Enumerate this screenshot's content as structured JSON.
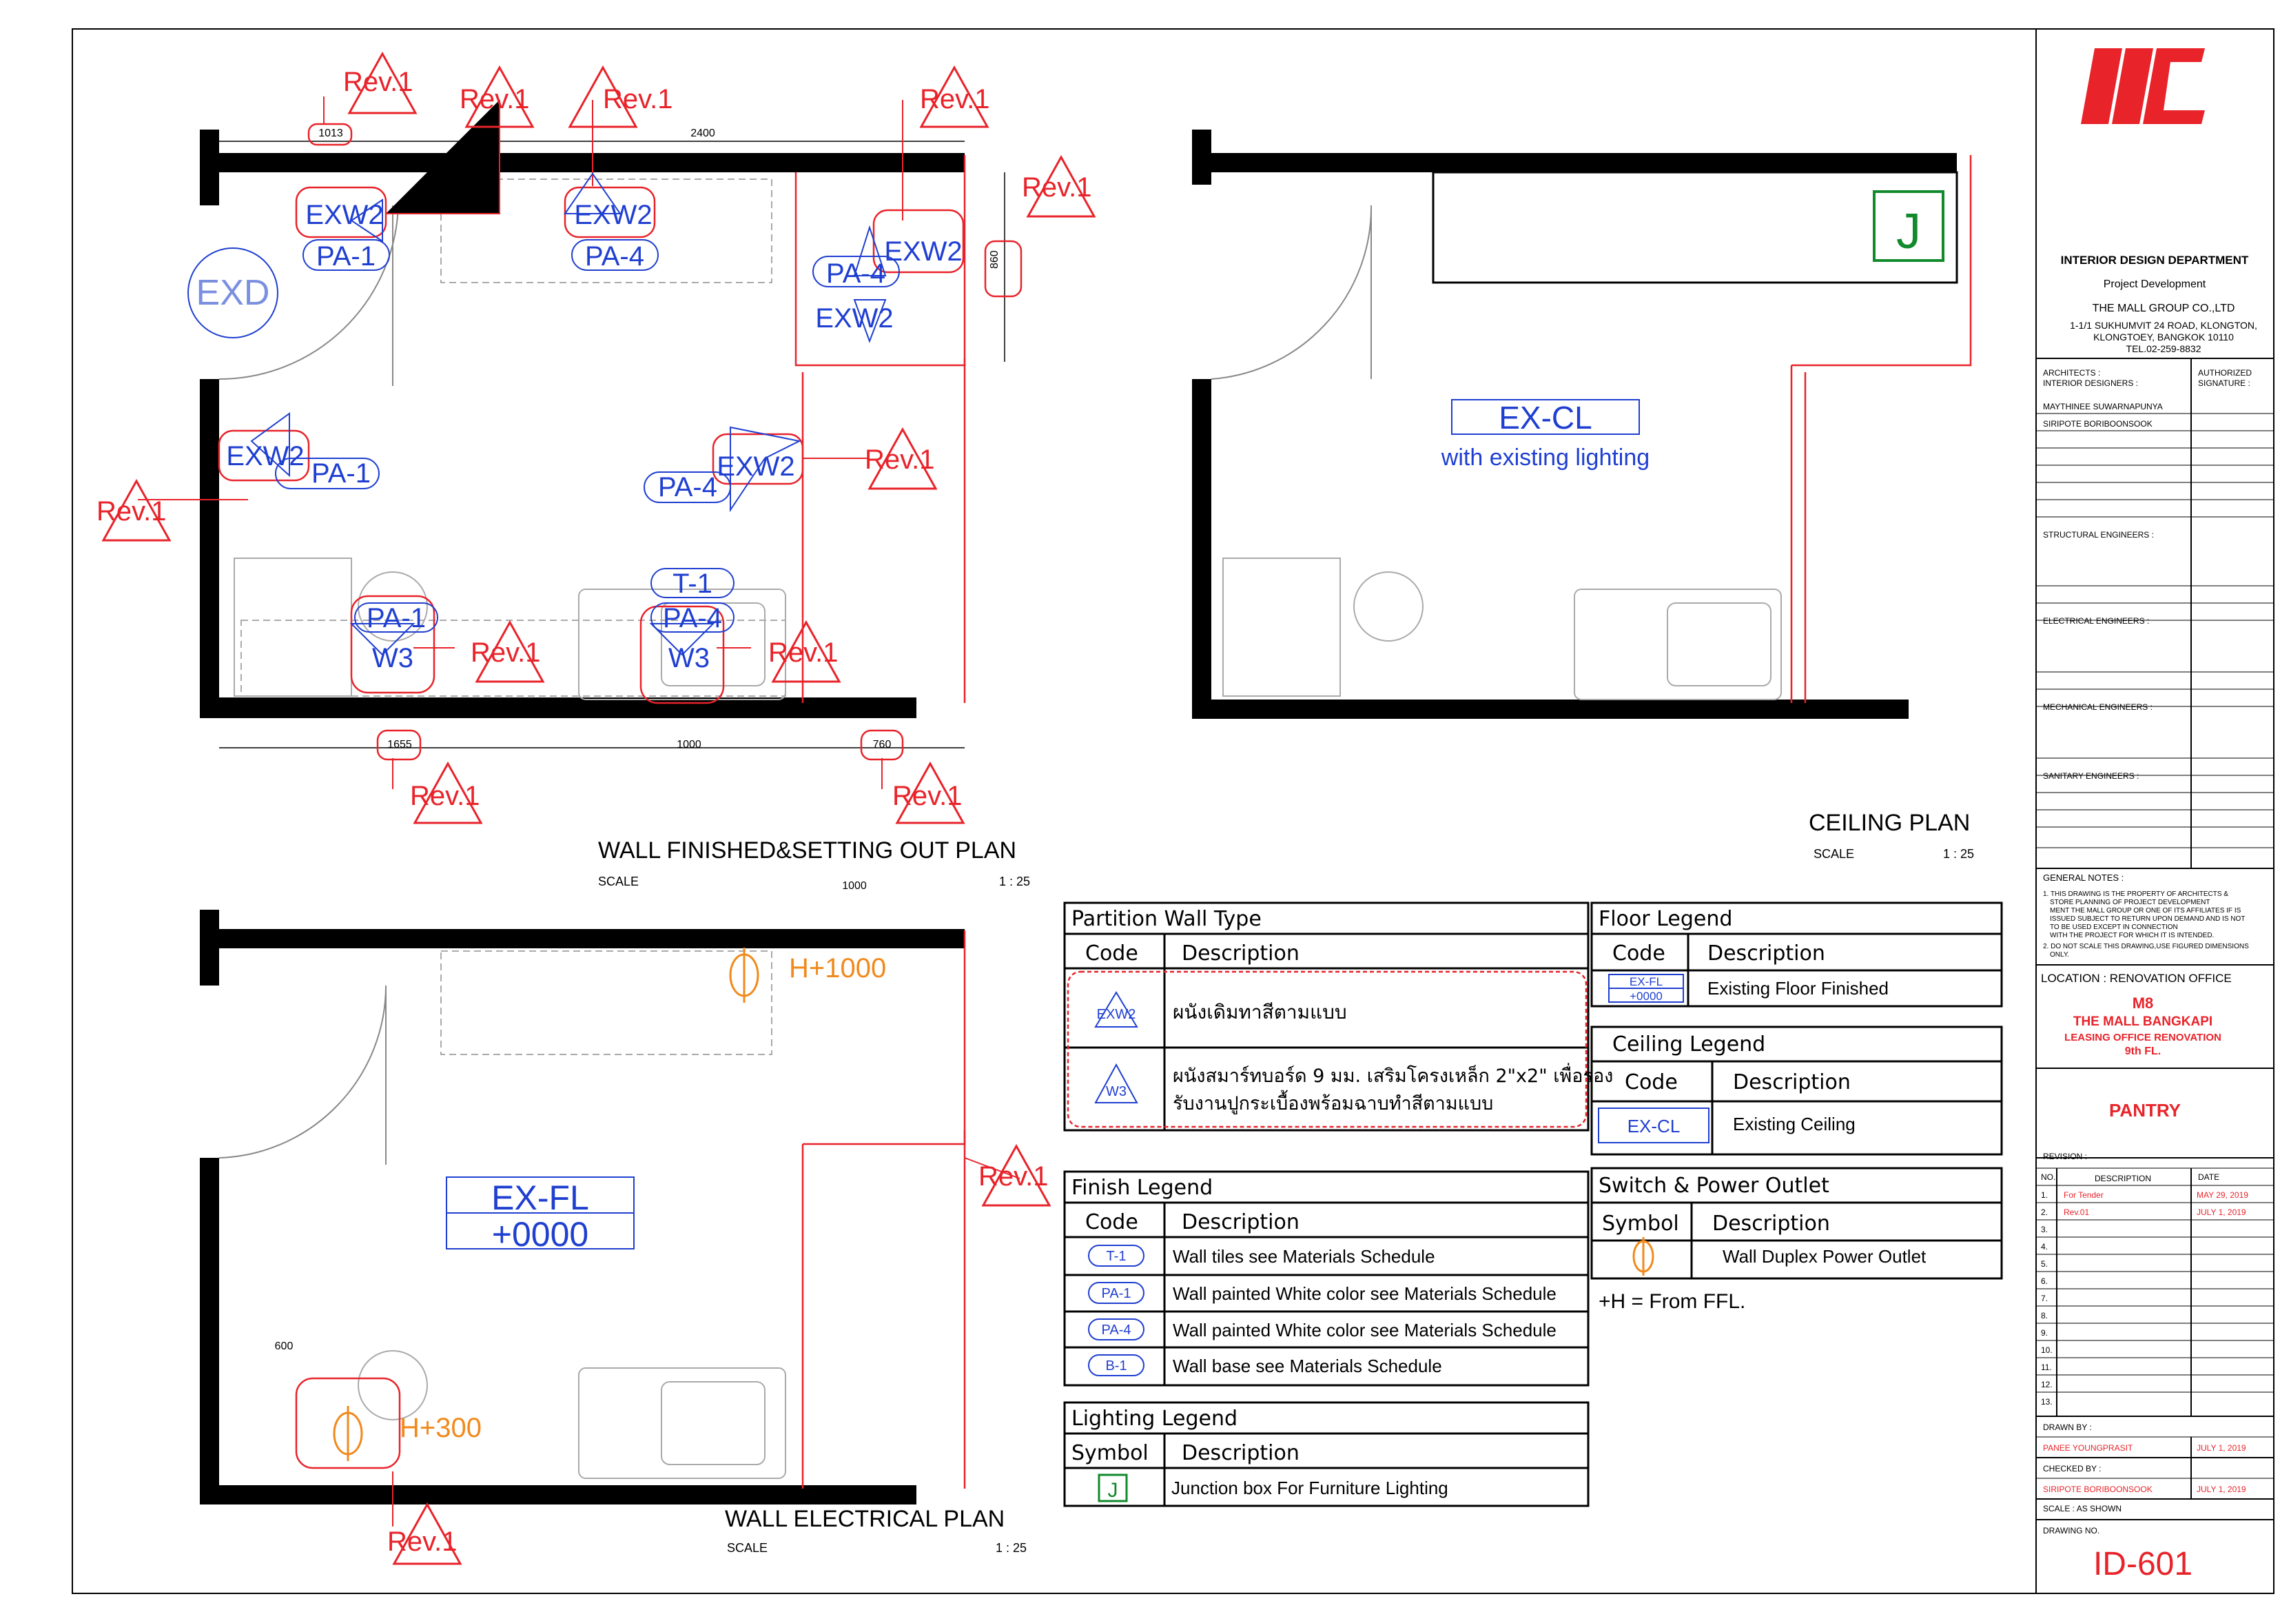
{
  "colors": {
    "wall": "#000000",
    "red": "#e8232a",
    "blue": "#1f3fd1",
    "orange": "#f08a1c",
    "green": "#118a2c",
    "grey": "#9a9a9a"
  },
  "plans": {
    "wall_finished": {
      "title": "WALL FINISHED&SETTING OUT PLAN",
      "scale_label": "SCALE",
      "scale": "1 : 25",
      "rev": "Rev.1",
      "dims": {
        "d1013": "1013",
        "d2400": "2400",
        "d860": "860",
        "d1655": "1655",
        "d1000": "1000",
        "d760": "760"
      },
      "door_tag": "EXD",
      "tags": {
        "exw2": "EXW2",
        "pa1": "PA-1",
        "pa4": "PA-4",
        "t1": "T-1",
        "w3": "W3"
      }
    },
    "ceiling": {
      "title": "CEILING PLAN",
      "scale_label": "SCALE",
      "scale": "1 : 25",
      "code": "EX-CL",
      "note": "with existing lighting",
      "junction": "J"
    },
    "wall_electrical": {
      "title": "WALL ELECTRICAL PLAN",
      "scale_label": "SCALE",
      "scale": "1 : 25",
      "rev": "Rev.1",
      "dims": {
        "d1000": "1000",
        "d600": "600"
      },
      "floor_code": "EX-FL",
      "floor_level": "+0000",
      "outlet_high": "H+1000",
      "outlet_low": "H+300"
    }
  },
  "legends": {
    "partition": {
      "title": "Partition  Wall  Type",
      "col_code": "Code",
      "col_desc": "Description",
      "rows": [
        {
          "code": "EXW2",
          "desc": "ผนังเดิมทาสีตามแบบ"
        },
        {
          "code": "W3",
          "desc_line1": "ผนังสมาร์ทบอร์ด 9 มม. เสริมโครงเหล็ก 2\"x2\" เพื่อรอง",
          "desc_line2": "รับงานปูกระเบื้องพร้อมฉาบทำสีตามแบบ"
        }
      ]
    },
    "finish": {
      "title": "Finish  Legend",
      "col_code": "Code",
      "col_desc": "Description",
      "rows": [
        {
          "code": "T-1",
          "desc": "Wall tiles see Materials Schedule"
        },
        {
          "code": "PA-1",
          "desc": "Wall painted White color see Materials Schedule"
        },
        {
          "code": "PA-4",
          "desc": "Wall painted White color see Materials Schedule"
        },
        {
          "code": "B-1",
          "desc": "Wall base see Materials Schedule"
        }
      ]
    },
    "lighting": {
      "title": "Lighting  Legend",
      "col_symbol": "Symbol",
      "col_desc": "Description",
      "rows": [
        {
          "code": "J",
          "desc": "Junction box For Furniture Lighting"
        }
      ]
    },
    "floor": {
      "title": "Floor  Legend",
      "col_code": "Code",
      "col_desc": "Description",
      "rows": [
        {
          "code1": "EX-FL",
          "code2": "+0000",
          "desc": "Existing Floor Finished"
        }
      ]
    },
    "ceiling": {
      "title": "Ceiling  Legend",
      "col_code": "Code",
      "col_desc": "Description",
      "rows": [
        {
          "code": "EX-CL",
          "desc": "Existing Ceiling"
        }
      ]
    },
    "switch": {
      "title": "Switch  &  Power  Outlet",
      "col_symbol": "Symbol",
      "col_desc": "Description",
      "rows": [
        {
          "desc": "Wall Duplex Power Outlet"
        }
      ],
      "note": "+H  = From FFL."
    }
  },
  "title_block": {
    "department": "INTERIOR DESIGN DEPARTMENT",
    "sub": "Project Development",
    "company": "THE MALL GROUP CO.,LTD",
    "addr1": "1-1/1 SUKHUMVIT 24 ROAD, KLONGTON,",
    "addr2": "KLONGTOEY, BANGKOK 10110",
    "tel": "TEL.02-259-8832",
    "architects_label1": "ARCHITECTS :",
    "architects_label2": "INTERIOR DESIGNERS :",
    "authorized1": "AUTHORIZED",
    "authorized2": "SIGNATURE :",
    "designer1": "MAYTHINEE SUWARNAPUNYA",
    "designer2": "SIRIPOTE BORIBOONSOOK",
    "structural": "STRUCTURAL  ENGINEERS :",
    "electrical": "ELECTRICAL  ENGINEERS :",
    "mechanical": "MECHANICAL  ENGINEERS :",
    "sanitary": "SANITARY  ENGINEERS :",
    "general_notes": "GENERAL NOTES :",
    "notes": [
      "1. THIS DRAWING IS THE PROPERTY OF ARCHITECTS &",
      "STORE PLANNING OF PROJECT DEVELOPMENT",
      "MENT THE MALL GROUP OR ONE OF ITS AFFILIATES IF IS",
      "ISSUED SUBJECT TO RETURN UPON DEMAND AND IS NOT",
      "TO BE USED EXCEPT IN CONNECTION",
      "WITH THE PROJECT FOR WHICH IT IS INTENDED.",
      "2. DO NOT SCALE THIS DRAWING,USE FIGURED DIMENSIONS",
      "ONLY."
    ],
    "location_label": "LOCATION : RENOVATION OFFICE",
    "loc1": "M8",
    "loc2": "THE MALL BANGKAPI",
    "loc3": "LEASING OFFICE RENOVATION",
    "loc4": "9th FL.",
    "drawing_title": "PANTRY",
    "revision_label": "REVISION :",
    "rev_headers": {
      "no": "NO.",
      "desc": "DESCRIPTION",
      "date": "DATE"
    },
    "revisions": [
      {
        "no": "1.",
        "desc": "For Tender",
        "date": "MAY 29, 2019"
      },
      {
        "no": "2.",
        "desc": "Rev.01",
        "date": "JULY 1, 2019"
      },
      {
        "no": "3.",
        "desc": "",
        "date": ""
      },
      {
        "no": "4.",
        "desc": "",
        "date": ""
      },
      {
        "no": "5.",
        "desc": "",
        "date": ""
      },
      {
        "no": "6.",
        "desc": "",
        "date": ""
      },
      {
        "no": "7.",
        "desc": "",
        "date": ""
      },
      {
        "no": "8.",
        "desc": "",
        "date": ""
      },
      {
        "no": "9.",
        "desc": "",
        "date": ""
      },
      {
        "no": "10.",
        "desc": "",
        "date": ""
      },
      {
        "no": "11.",
        "desc": "",
        "date": ""
      },
      {
        "no": "12.",
        "desc": "",
        "date": ""
      },
      {
        "no": "13.",
        "desc": "",
        "date": ""
      }
    ],
    "drawn_label": "DRAWN  BY :",
    "drawn_name": "PANEE YOUNGPRASIT",
    "drawn_date": "JULY 1, 2019",
    "checked_label": "CHECKED  BY :",
    "checked_name": "SIRIPOTE BORIBOONSOOK",
    "checked_date": "JULY 1, 2019",
    "scale_label": "SCALE  : AS SHOWN",
    "drawing_no_label": "DRAWING NO.",
    "drawing_no": "ID-601"
  }
}
